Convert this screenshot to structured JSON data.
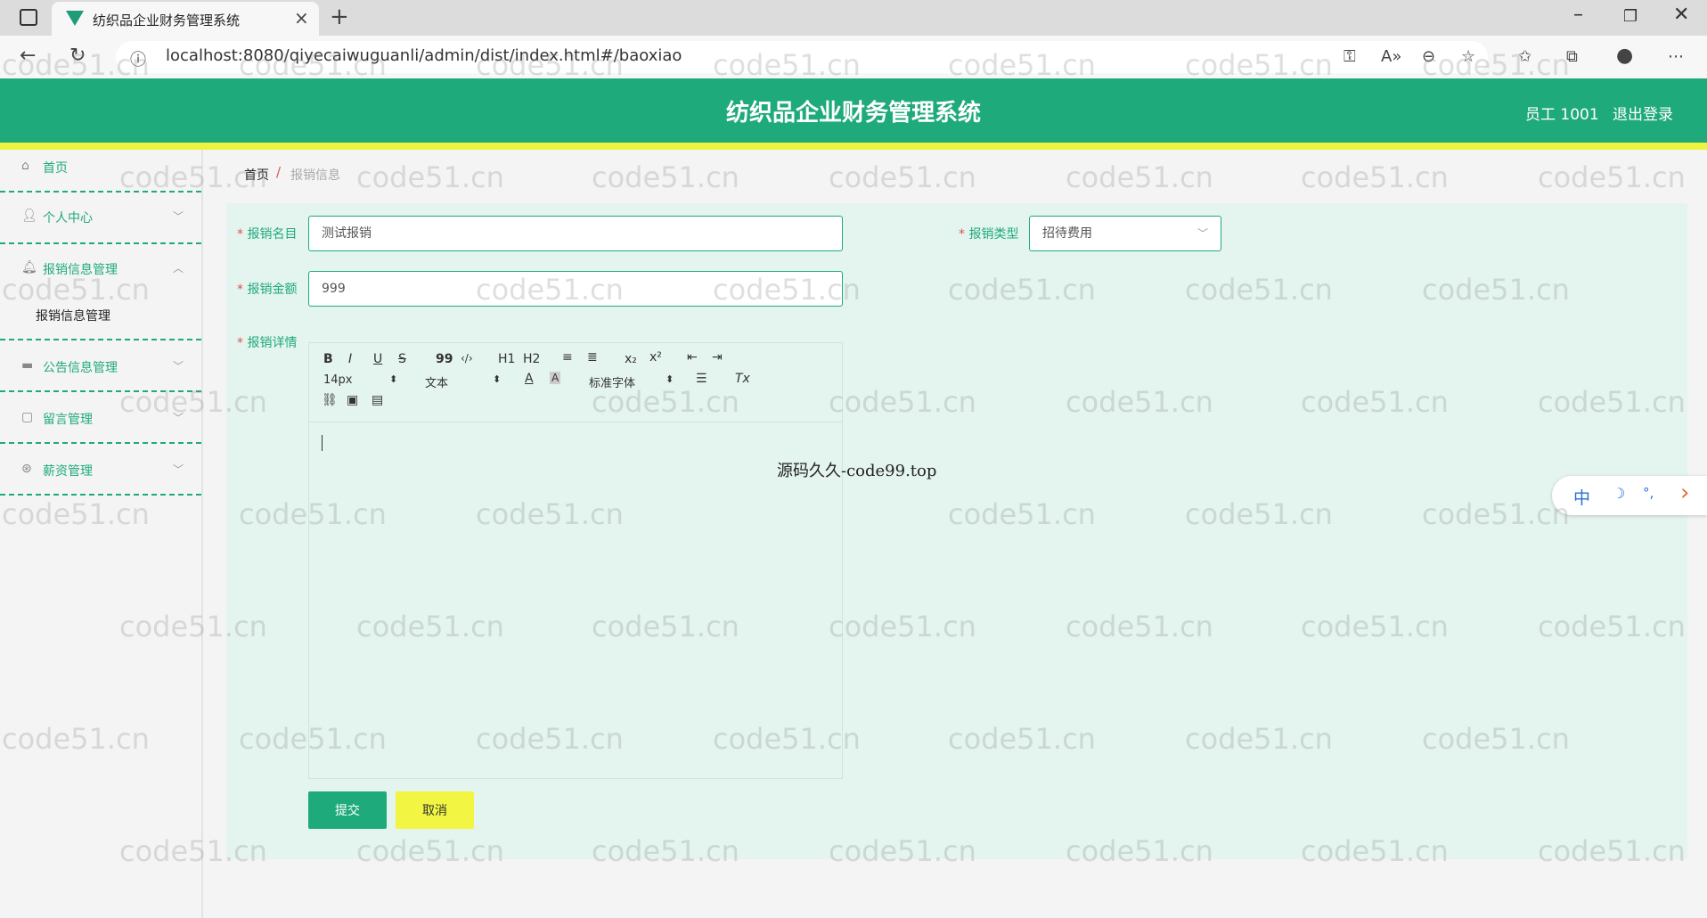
{
  "browser": {
    "tab_title": "纺织品企业财务管理系统",
    "url": "localhost:8080/qiyecaiwuguanli/admin/dist/index.html#/baoxiao"
  },
  "header": {
    "title": "纺织品企业财务管理系统",
    "user": "员工 1001",
    "logout": "退出登录"
  },
  "sidebar": {
    "items": [
      {
        "label": "首页",
        "icon": "home-icon"
      },
      {
        "label": "个人中心",
        "icon": "user-icon"
      },
      {
        "label": "报销信息管理",
        "icon": "bell-icon"
      },
      {
        "label": "公告信息管理",
        "icon": "notice-icon"
      },
      {
        "label": "留言管理",
        "icon": "message-icon"
      },
      {
        "label": "薪资管理",
        "icon": "salary-icon"
      }
    ],
    "sub_item": "报销信息管理"
  },
  "breadcrumb": {
    "home": "首页",
    "separator": "/",
    "current": "报销信息"
  },
  "form": {
    "name_label": "报销名目",
    "name_value": "测试报销",
    "type_label": "报销类型",
    "type_value": "招待费用",
    "amount_label": "报销金额",
    "amount_value": "999",
    "detail_label": "报销详情",
    "required_mark": "*"
  },
  "editor": {
    "font_size": "14px",
    "header_select": "文本",
    "font_family": "标准字体",
    "toolbar": {
      "bold": "B",
      "italic": "I",
      "underline": "U",
      "strike": "S",
      "quote": "99",
      "code": "‹/›",
      "h1": "H1",
      "h2": "H2",
      "ol": "≡",
      "ul": "≣",
      "sub": "x₂",
      "sup": "x²",
      "outdent": "⇤",
      "indent": "⇥",
      "color": "A",
      "bg": "A",
      "align": "☰",
      "clean": "Tx",
      "link": "⛓",
      "image": "▣",
      "video": "▤",
      "select_arrow": "⬍"
    }
  },
  "buttons": {
    "submit": "提交",
    "cancel": "取消"
  },
  "overlay": "源码久久-code99.top",
  "watermark": "code51.cn",
  "ime": {
    "lang": "中",
    "moon": "☽",
    "punct": "°,",
    "arrow": "›"
  },
  "colors": {
    "primary": "#1faa7b",
    "accent": "#eef33f",
    "required": "#e05050"
  }
}
